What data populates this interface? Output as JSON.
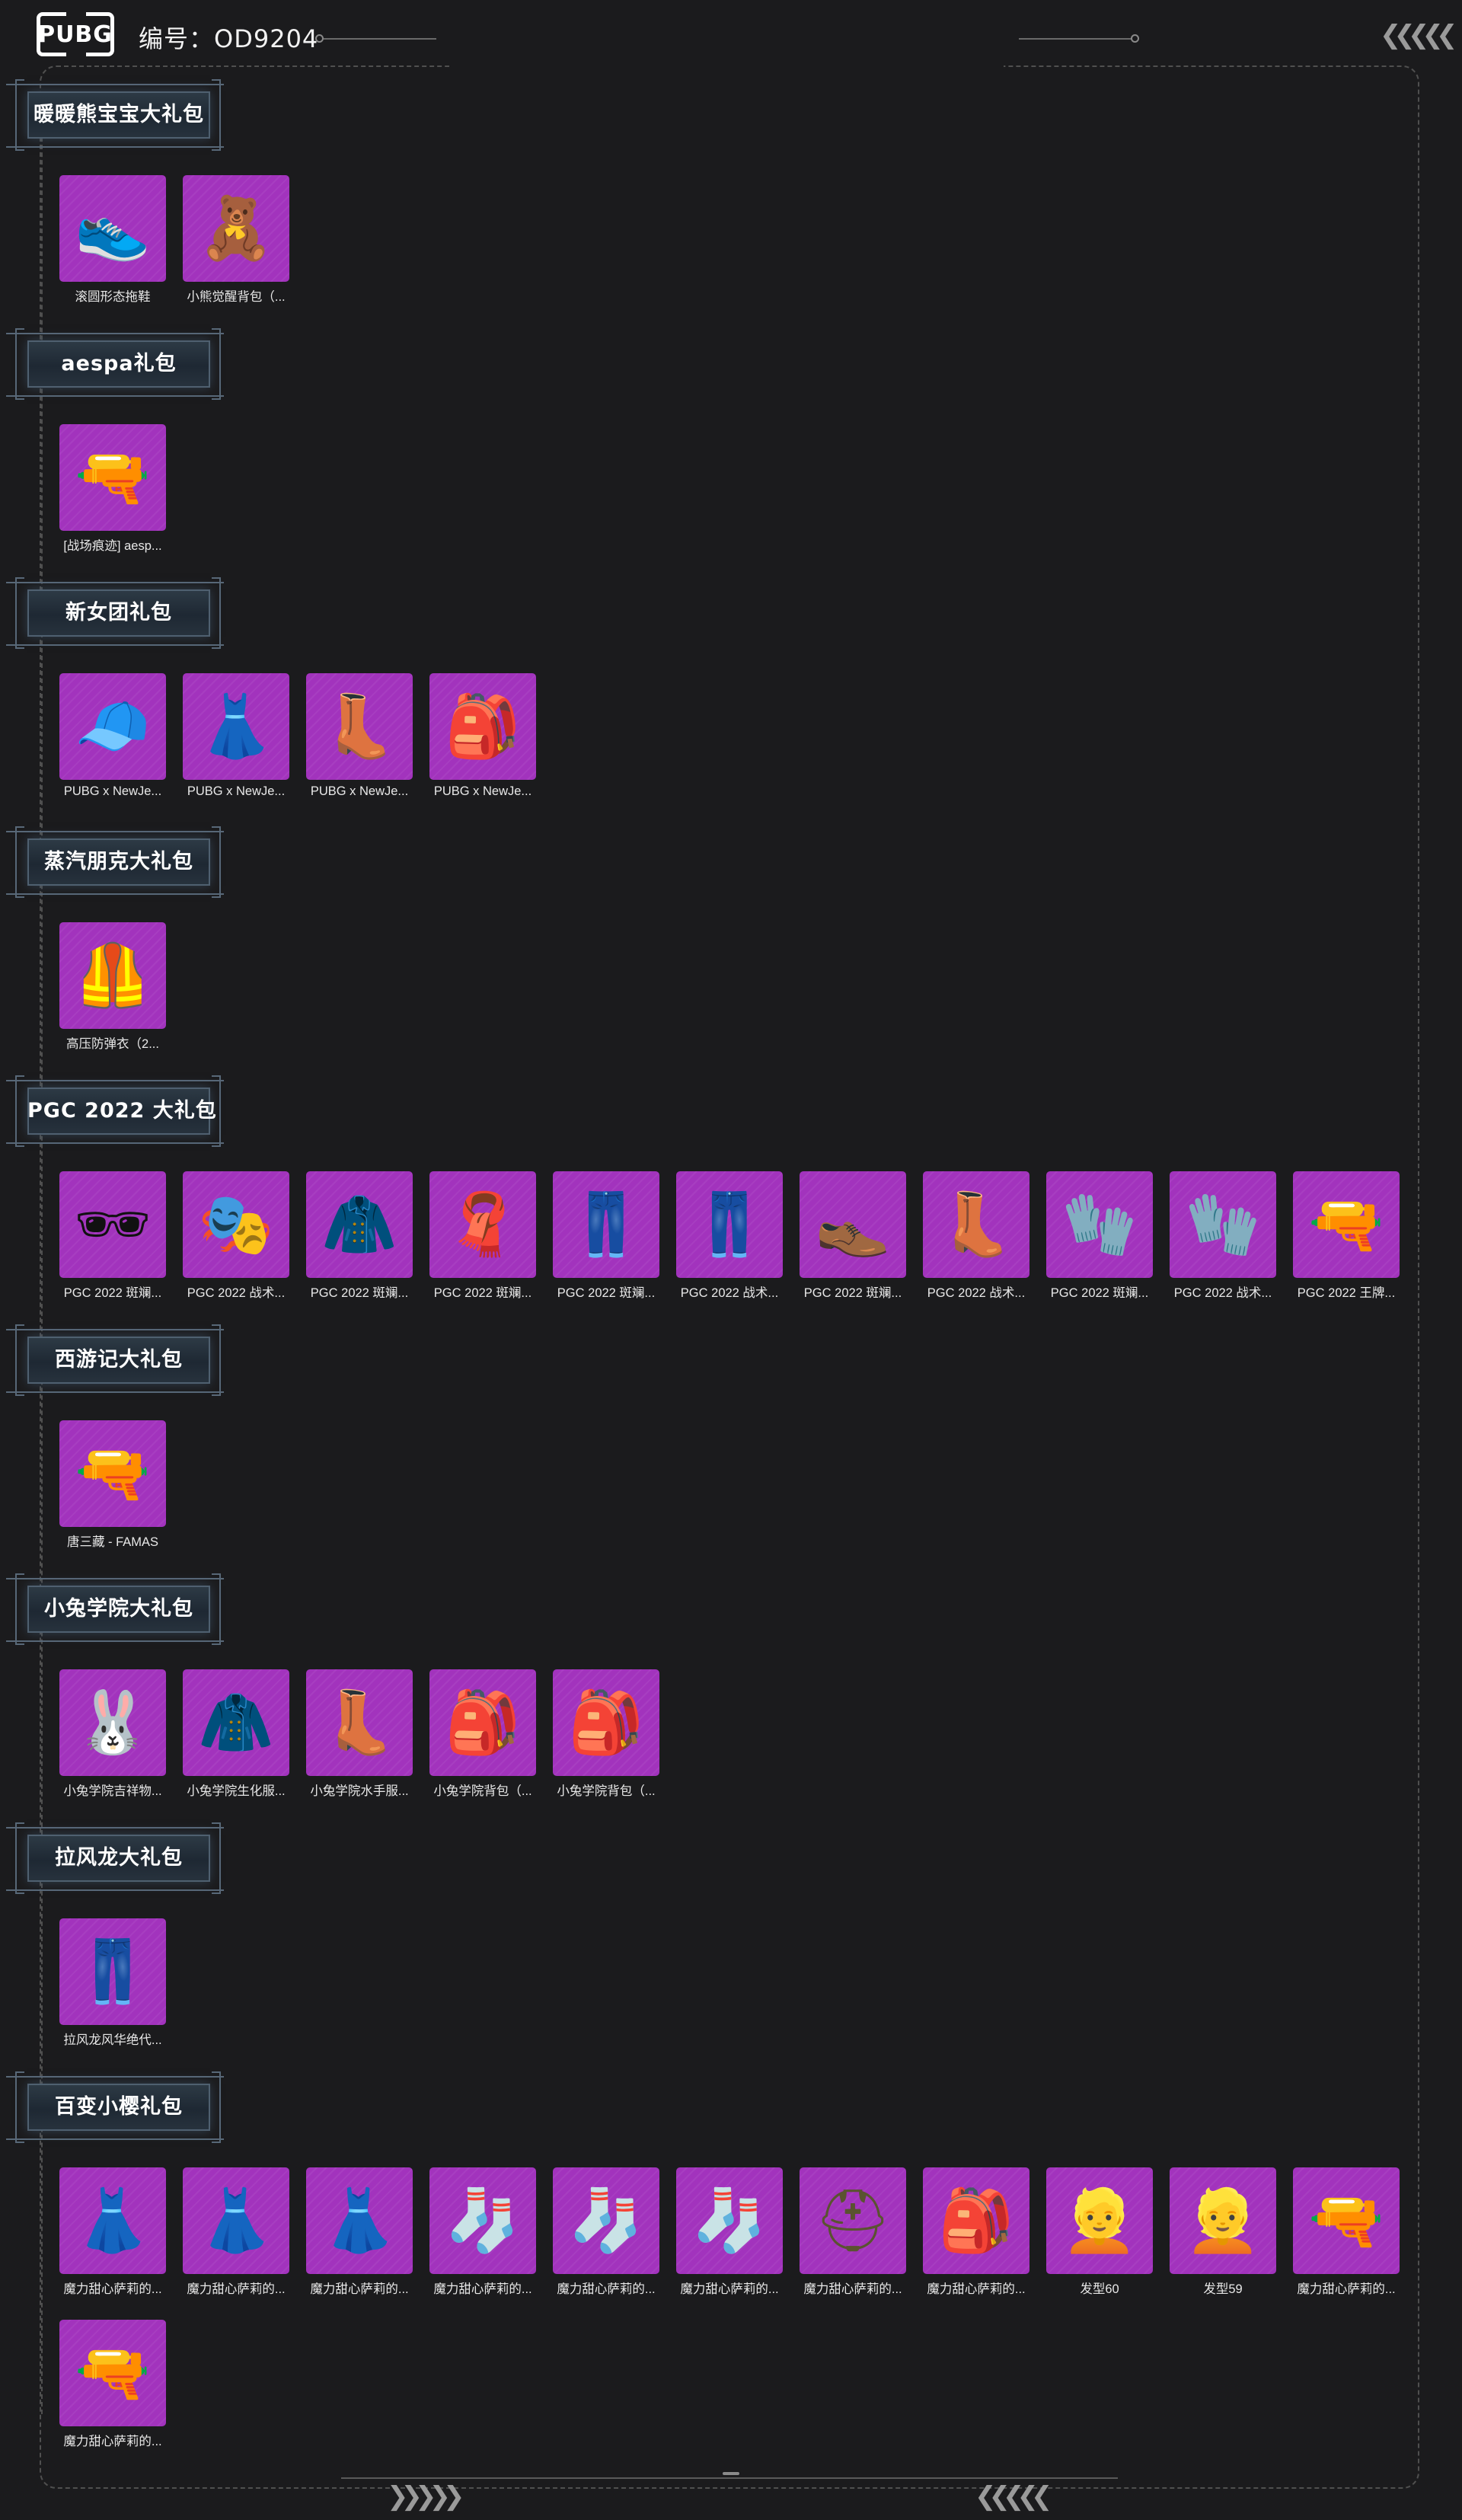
{
  "header": {
    "logo": "PUBG",
    "id_label": "编号：",
    "id_value": "OD9204",
    "chevrons": "❮❮❮❮❮"
  },
  "footer": {
    "left_chevrons": "❯❯❯❯❯",
    "right_chevrons": "❮❮❮❮❮"
  },
  "sections": [
    {
      "title": "暖暖熊宝宝大礼包",
      "items": [
        {
          "name": "滚圆形态拖鞋",
          "icon": "slippers-icon",
          "glyph": "👟",
          "color": "#d6b98c"
        },
        {
          "name": "小熊觉醒背包（...",
          "icon": "teddy-bear-icon",
          "glyph": "🧸",
          "color": "#c08a55"
        }
      ]
    },
    {
      "title": "aespa礼包",
      "items": [
        {
          "name": "[战场痕迹] aesp...",
          "icon": "rifle-icon",
          "glyph": "🔫",
          "color": "#cfd3e0"
        }
      ]
    },
    {
      "title": "新女团礼包",
      "items": [
        {
          "name": "PUBG x NewJe...",
          "icon": "beanie-icon",
          "glyph": "🧢",
          "color": "#e8b4b8"
        },
        {
          "name": "PUBG x NewJe...",
          "icon": "dress-icon",
          "glyph": "👗",
          "color": "#f2eee8"
        },
        {
          "name": "PUBG x NewJe...",
          "icon": "boots-icon",
          "glyph": "👢",
          "color": "#f0f0f0"
        },
        {
          "name": "PUBG x NewJe...",
          "icon": "backpack-icon",
          "glyph": "🎒",
          "color": "#f4b6cf"
        }
      ]
    },
    {
      "title": "蒸汽朋克大礼包",
      "items": [
        {
          "name": "高压防弹衣（2...",
          "icon": "vest-icon",
          "glyph": "🦺",
          "color": "#6d4f3a"
        }
      ]
    },
    {
      "title": "PGC 2022 大礼包",
      "items": [
        {
          "name": "PGC 2022 斑斓...",
          "icon": "goggles-icon",
          "glyph": "🕶",
          "color": "#111111"
        },
        {
          "name": "PGC 2022 战术...",
          "icon": "mask-icon",
          "glyph": "🎭",
          "color": "#1a1a1a"
        },
        {
          "name": "PGC 2022 斑斓...",
          "icon": "jacket-icon",
          "glyph": "🧥",
          "color": "#1c1c1c"
        },
        {
          "name": "PGC 2022 斑斓...",
          "icon": "scarf-icon",
          "glyph": "🧣",
          "color": "#3c3552"
        },
        {
          "name": "PGC 2022 斑斓...",
          "icon": "pants-icon",
          "glyph": "👖",
          "color": "#141414"
        },
        {
          "name": "PGC 2022 战术...",
          "icon": "tactical-pants-icon",
          "glyph": "👖",
          "color": "#202020"
        },
        {
          "name": "PGC 2022 斑斓...",
          "icon": "shoes-icon",
          "glyph": "👞",
          "color": "#151515"
        },
        {
          "name": "PGC 2022 战术...",
          "icon": "boots-icon",
          "glyph": "👢",
          "color": "#171717"
        },
        {
          "name": "PGC 2022 斑斓...",
          "icon": "gloves-icon",
          "glyph": "🧤",
          "color": "#121212"
        },
        {
          "name": "PGC 2022 战术...",
          "icon": "gloves-icon",
          "glyph": "🧤",
          "color": "#1d1d1d"
        },
        {
          "name": "PGC 2022 王牌...",
          "icon": "rifle-icon",
          "glyph": "🔫",
          "color": "#1f1f1f"
        }
      ]
    },
    {
      "title": "西游记大礼包",
      "items": [
        {
          "name": "唐三藏 - FAMAS",
          "icon": "rifle-icon",
          "glyph": "🔫",
          "color": "#c9a24a"
        }
      ]
    },
    {
      "title": "小兔学院大礼包",
      "items": [
        {
          "name": "小兔学院吉祥物...",
          "icon": "bunny-mask-icon",
          "glyph": "🐰",
          "color": "#f0d2b4"
        },
        {
          "name": "小兔学院生化服...",
          "icon": "jacket-icon",
          "glyph": "🧥",
          "color": "#f2f2f2"
        },
        {
          "name": "小兔学院水手服...",
          "icon": "boots-icon",
          "glyph": "👢",
          "color": "#d9a0a8"
        },
        {
          "name": "小兔学院背包（...",
          "icon": "backpack-icon",
          "glyph": "🎒",
          "color": "#8c94a8"
        },
        {
          "name": "小兔学院背包（...",
          "icon": "backpack-icon",
          "glyph": "🎒",
          "color": "#f4a6c0"
        }
      ]
    },
    {
      "title": "拉风龙大礼包",
      "items": [
        {
          "name": "拉风龙风华绝代...",
          "icon": "pants-icon",
          "glyph": "👖",
          "color": "#3a3a2a"
        }
      ]
    },
    {
      "title": "百变小樱礼包",
      "items": [
        {
          "name": "魔力甜心萨莉的...",
          "icon": "dress-icon",
          "glyph": "👗",
          "color": "#2b2f8c"
        },
        {
          "name": "魔力甜心萨莉的...",
          "icon": "dress-icon",
          "glyph": "👗",
          "color": "#f07a2a"
        },
        {
          "name": "魔力甜心萨莉的...",
          "icon": "dress-icon",
          "glyph": "👗",
          "color": "#f3a6c4"
        },
        {
          "name": "魔力甜心萨莉的...",
          "icon": "stockings-icon",
          "glyph": "🧦",
          "color": "#a9c2e8"
        },
        {
          "name": "魔力甜心萨莉的...",
          "icon": "stockings-icon",
          "glyph": "🧦",
          "color": "#f2a25a"
        },
        {
          "name": "魔力甜心萨莉的...",
          "icon": "stockings-icon",
          "glyph": "🧦",
          "color": "#f4c6d6"
        },
        {
          "name": "魔力甜心萨莉的...",
          "icon": "helmet-icon",
          "glyph": "⛑",
          "color": "#5a5330"
        },
        {
          "name": "魔力甜心萨莉的...",
          "icon": "winged-backpack-icon",
          "glyph": "🎒",
          "color": "#e8b84a"
        },
        {
          "name": "发型60",
          "icon": "hair-icon",
          "glyph": "👱",
          "color": "#e6cf9a"
        },
        {
          "name": "发型59",
          "icon": "hair-icon",
          "glyph": "👱",
          "color": "#e8c890"
        },
        {
          "name": "魔力甜心萨莉的...",
          "icon": "rifle-icon",
          "glyph": "🔫",
          "color": "#e89a88"
        },
        {
          "name": "魔力甜心萨莉的...",
          "icon": "rifle-icon",
          "glyph": "🔫",
          "color": "#b8c0d8"
        }
      ]
    }
  ]
}
